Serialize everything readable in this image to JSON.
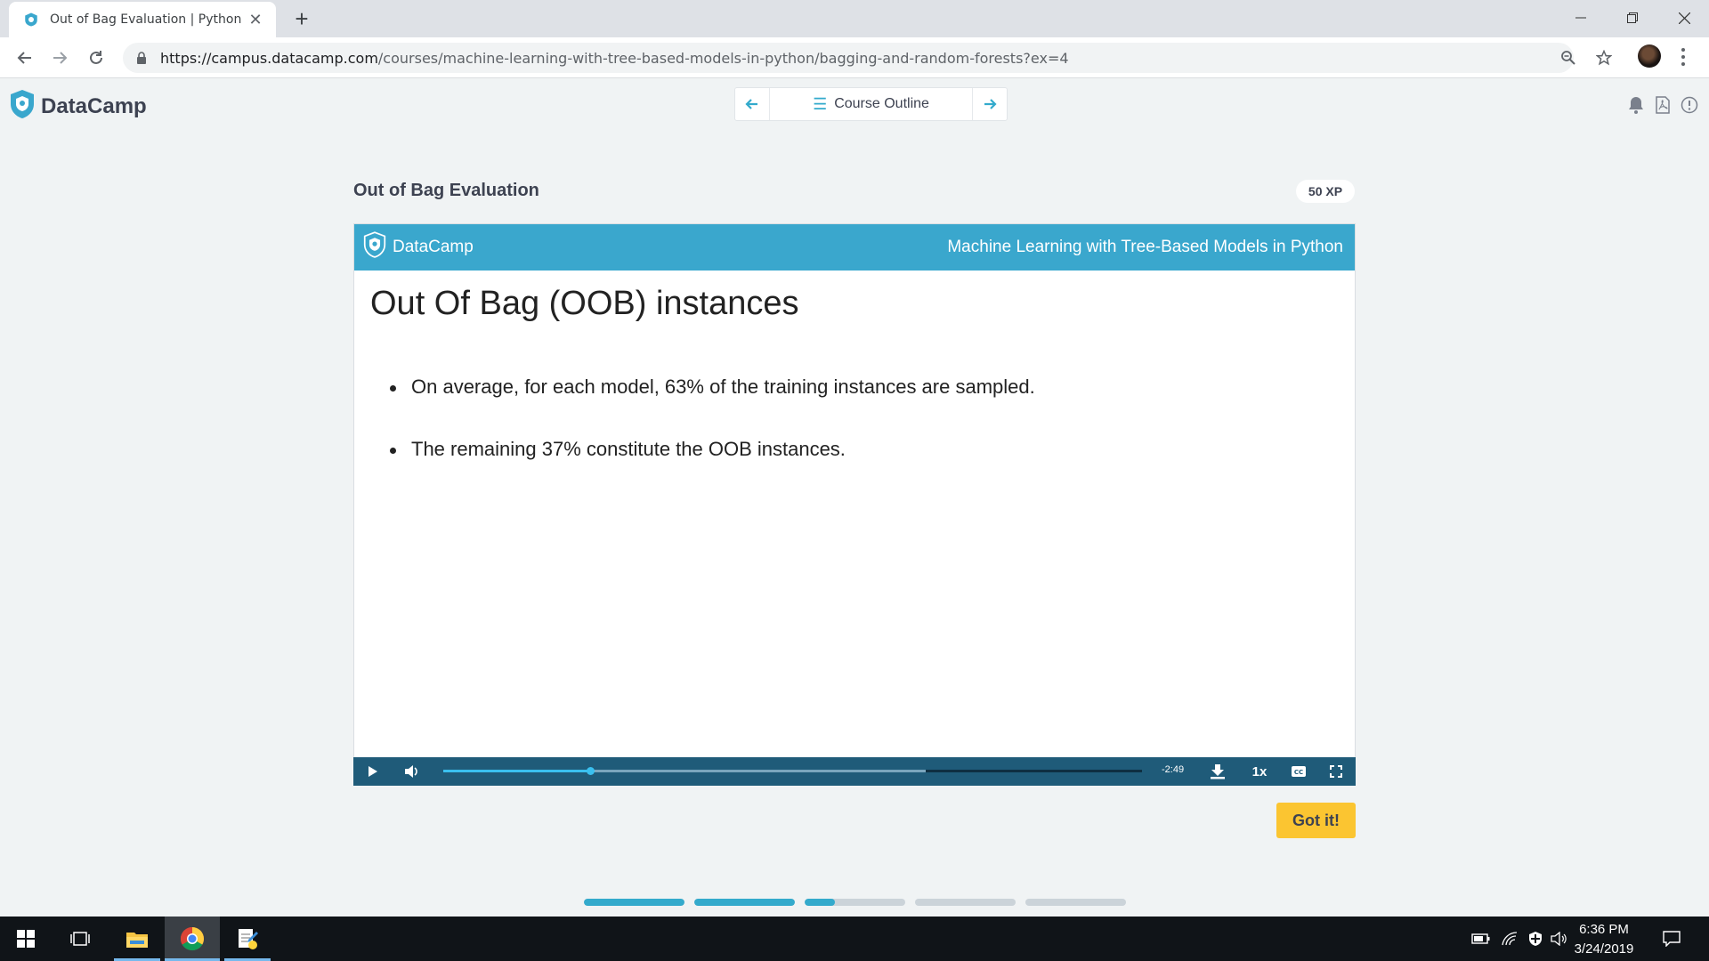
{
  "browser": {
    "tab_title": "Out of Bag Evaluation | Python",
    "url_host": "https://campus.datacamp.com",
    "url_path": "/courses/machine-learning-with-tree-based-models-in-python/bagging-and-random-forests?ex=4"
  },
  "header": {
    "logo": "DataCamp",
    "course_outline": "Course Outline"
  },
  "exercise": {
    "title": "Out of Bag Evaluation",
    "xp": "50 XP",
    "got_it": "Got it!"
  },
  "slide": {
    "brand": "DataCamp",
    "course": "Machine Learning with Tree-Based Models in Python",
    "title": "Out Of Bag (OOB) instances",
    "bullets": [
      "On average, for each model, 63% of the training instances are sampled.",
      "The remaining 37% constitute the OOB instances."
    ]
  },
  "player": {
    "time": "-2:49",
    "speed": "1x",
    "played_fraction": 0.21,
    "buffered_fraction": 0.69
  },
  "lesson_progress": [
    1,
    1,
    0.3,
    0,
    0
  ],
  "taskbar": {
    "time": "6:36 PM",
    "date": "3/24/2019"
  },
  "colors": {
    "brand_blue": "#3aa7cd",
    "player_bg": "#1f5b79",
    "got_it": "#fbc531"
  }
}
